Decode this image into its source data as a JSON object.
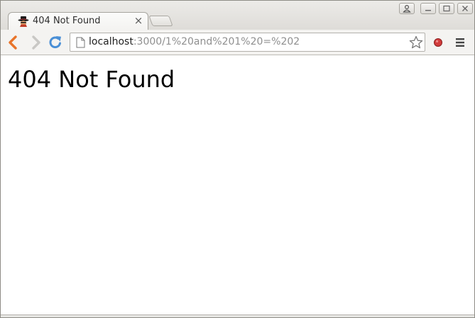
{
  "tab": {
    "title": "404 Not Found",
    "close_label": "×",
    "favicon": "incognito-icon"
  },
  "toolbar": {
    "back_icon": "back-arrow-icon",
    "forward_icon": "forward-arrow-icon",
    "reload_icon": "reload-icon",
    "url_host": "localhost",
    "url_path": ":3000/1%20and%201%20=%202",
    "page_icon": "page-icon",
    "bookmark_icon": "star-icon",
    "extension_icon": "record-icon",
    "menu_icon": "menu-icon"
  },
  "window_controls": [
    "user-icon",
    "minimize-icon",
    "maximize-icon",
    "close-icon"
  ],
  "page": {
    "heading": "404 Not Found"
  },
  "colors": {
    "back_arrow": "#e8742a",
    "reload": "#4a8fd6",
    "record": "#d23c3c"
  }
}
